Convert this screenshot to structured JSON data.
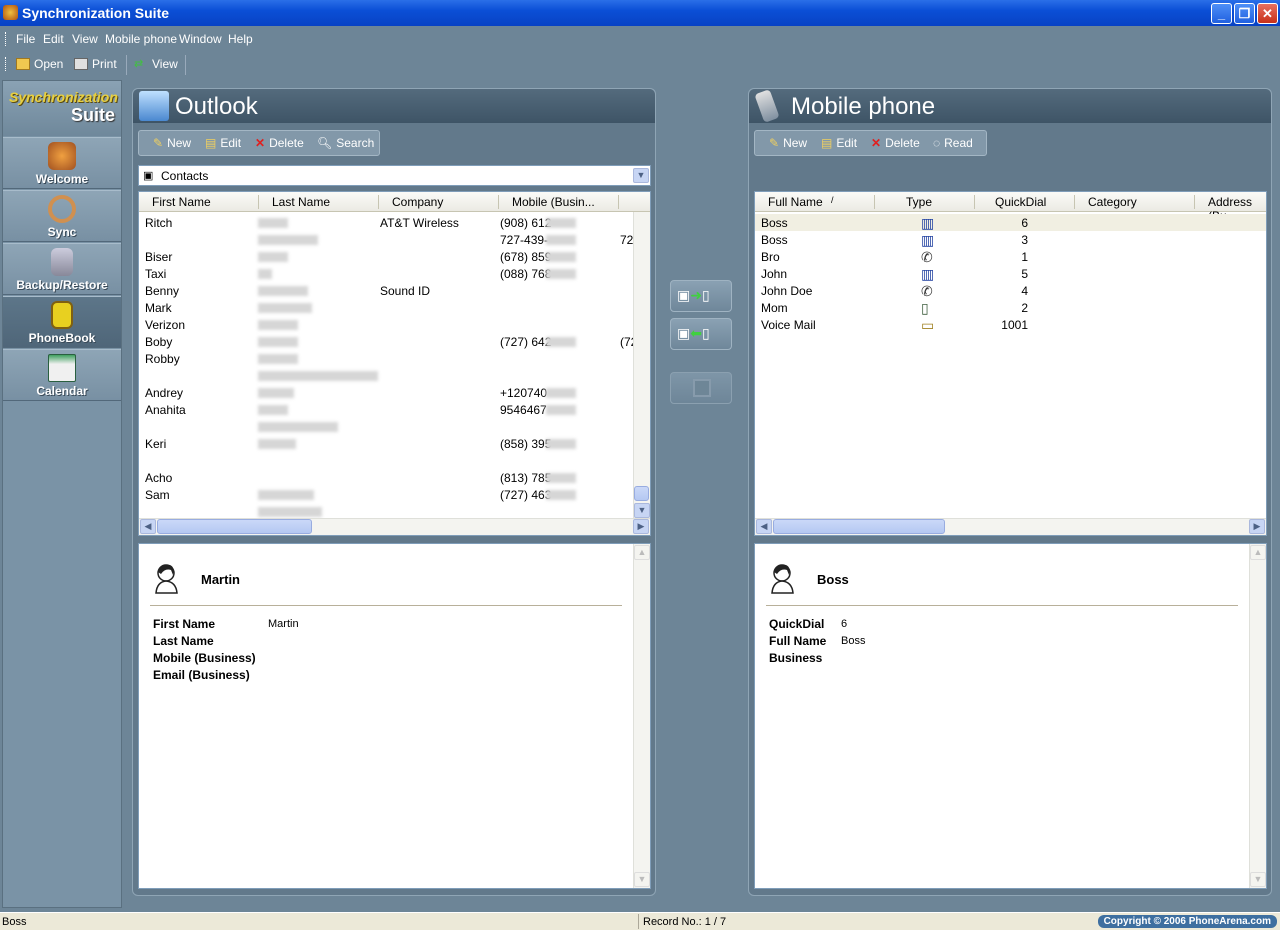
{
  "window": {
    "title": "Synchronization Suite"
  },
  "menu": [
    "File",
    "Edit",
    "View",
    "Mobile phone",
    "Window",
    "Help"
  ],
  "toolbar": {
    "open": "Open",
    "print": "Print",
    "view": "View"
  },
  "brand": {
    "line1": "Synchronization",
    "line2": "Suite"
  },
  "nav": [
    "Welcome",
    "Sync",
    "Backup/Restore",
    "PhoneBook",
    "Calendar"
  ],
  "outlook": {
    "title": "Outlook",
    "buttons": {
      "new": "New",
      "edit": "Edit",
      "delete": "Delete",
      "search": "Search"
    },
    "folder": "Contacts",
    "columns": [
      "First Name",
      "Last Name",
      "Company",
      "Mobile (Busin..."
    ],
    "rows": [
      {
        "first": "Ritch",
        "company": "AT&T Wireless",
        "mobile": "(908) 612"
      },
      {
        "first": "",
        "company": "",
        "mobile": "727-439-",
        "extra": "72"
      },
      {
        "first": "Biser",
        "company": "",
        "mobile": "(678) 859"
      },
      {
        "first": "Taxi",
        "company": "",
        "mobile": "(088) 768"
      },
      {
        "first": "Benny",
        "company": "Sound ID",
        "mobile": ""
      },
      {
        "first": "Mark",
        "company": "",
        "mobile": ""
      },
      {
        "first": "Verizon",
        "company": "",
        "mobile": ""
      },
      {
        "first": "Boby",
        "company": "",
        "mobile": "(727) 642",
        "extra": "(72"
      },
      {
        "first": "Robby",
        "company": "",
        "mobile": ""
      },
      {
        "first": "",
        "company": "",
        "mobile": ""
      },
      {
        "first": "Andrey",
        "company": "",
        "mobile": "+120740"
      },
      {
        "first": "Anahita",
        "company": "",
        "mobile": "9546467"
      },
      {
        "first": "",
        "company": "",
        "mobile": ""
      },
      {
        "first": "Keri",
        "company": "",
        "mobile": "(858) 395"
      },
      {
        "first": "",
        "company": "",
        "mobile": ""
      },
      {
        "first": "Acho",
        "company": "",
        "mobile": "(813) 785"
      },
      {
        "first": "Sam",
        "company": "",
        "mobile": "(727) 463"
      },
      {
        "first": "",
        "company": "",
        "mobile": ""
      }
    ],
    "detail": {
      "name": "Martin",
      "fields": [
        {
          "label": "First Name",
          "value": "Martin"
        },
        {
          "label": "Last Name",
          "value": ""
        },
        {
          "label": "Mobile (Business)",
          "value": ""
        },
        {
          "label": "Email (Business)",
          "value": ""
        }
      ]
    }
  },
  "mobile": {
    "title": "Mobile phone",
    "buttons": {
      "new": "New",
      "edit": "Edit",
      "delete": "Delete",
      "read": "Read"
    },
    "columns": [
      "Full Name",
      "Type",
      "QuickDial",
      "Category",
      "Address (Bu"
    ],
    "rows": [
      {
        "name": "Boss",
        "type": "business-phone-icon",
        "quickdial": "6"
      },
      {
        "name": "Boss",
        "type": "business-phone-icon",
        "quickdial": "3"
      },
      {
        "name": "Bro",
        "type": "handset-icon",
        "quickdial": "1"
      },
      {
        "name": "John",
        "type": "business-phone-icon",
        "quickdial": "5"
      },
      {
        "name": "John Doe",
        "type": "handset-icon",
        "quickdial": "4"
      },
      {
        "name": "Mom",
        "type": "mobile-phone-icon",
        "quickdial": "2"
      },
      {
        "name": "Voice Mail",
        "type": "voicemail-icon",
        "quickdial": "1001"
      }
    ],
    "detail": {
      "name": "Boss",
      "fields": [
        {
          "label": "QuickDial",
          "value": "6"
        },
        {
          "label": "Full Name",
          "value": "Boss"
        },
        {
          "label": "Business",
          "value": ""
        }
      ]
    }
  },
  "status": {
    "left": "Boss",
    "record": "Record No.: 1 / 7",
    "copyright": "Copyright © 2006 PhoneArena.com"
  }
}
